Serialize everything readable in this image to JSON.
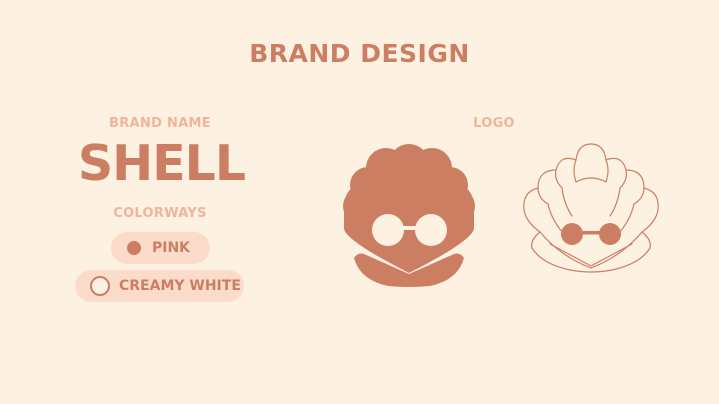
{
  "title": "BRAND DESIGN",
  "brand": {
    "section_label": "BRAND NAME",
    "name": "SHELL"
  },
  "colorways": {
    "section_label": "COLORWAYS",
    "options": [
      {
        "label": "PINK",
        "swatch": "#cc7e63",
        "swatch_style": "filled"
      },
      {
        "label": "CREAMY WHITE",
        "swatch": "#fdf1e1",
        "swatch_style": "outlined"
      }
    ]
  },
  "logo": {
    "section_label": "LOGO",
    "variants": [
      {
        "style": "filled",
        "color": "#cc7e63"
      },
      {
        "style": "outline",
        "color": "#cc7e63"
      }
    ]
  },
  "colors": {
    "background": "#fdf1e1",
    "accent": "#cc7e63",
    "label": "#f0b49a",
    "pill_background": "#fbdccb"
  }
}
